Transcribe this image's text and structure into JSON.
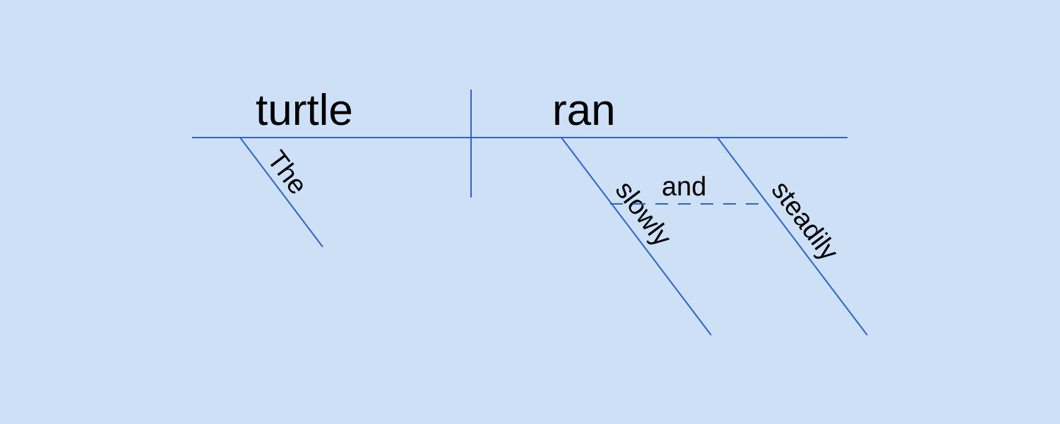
{
  "diagram": {
    "subject": "turtle",
    "predicate": "ran",
    "article": "The",
    "conjunction": "and",
    "adverb1": "slowly",
    "adverb2": "steadily"
  }
}
